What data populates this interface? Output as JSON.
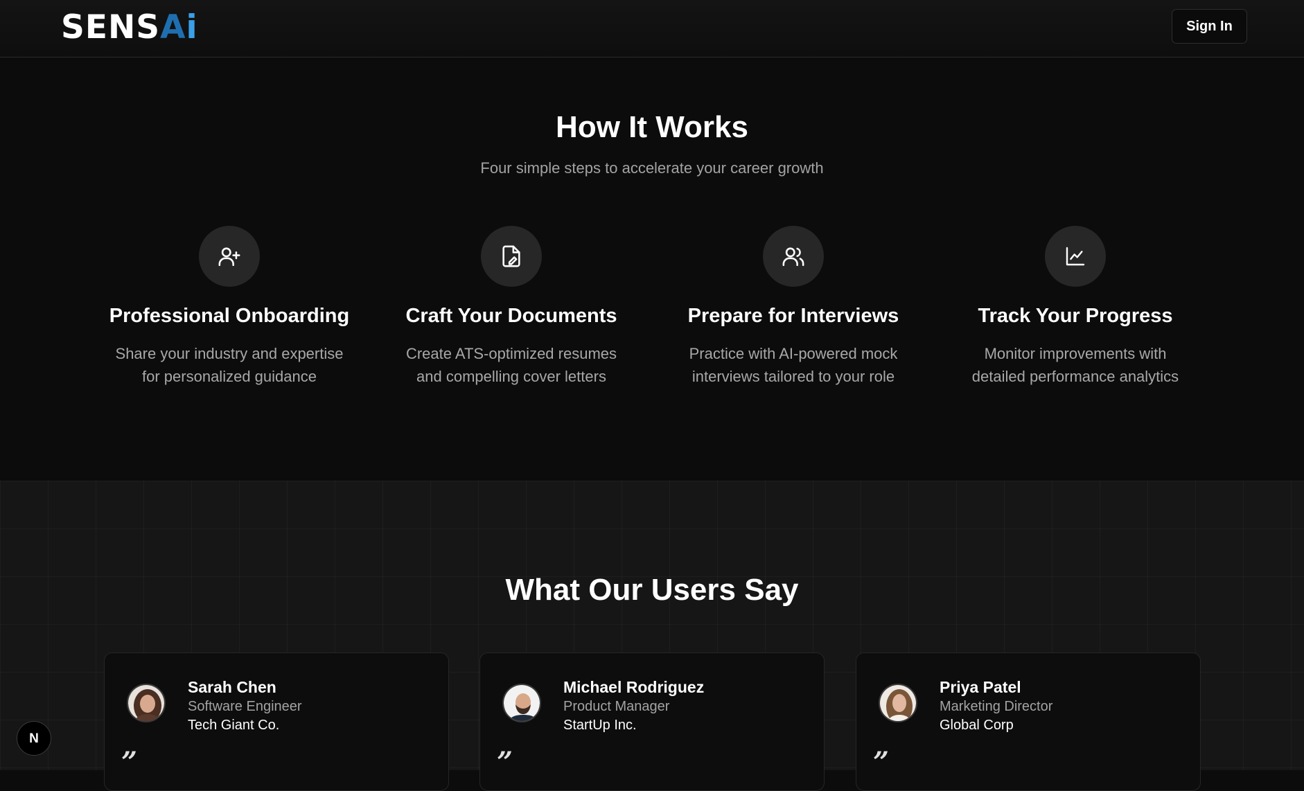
{
  "header": {
    "logo_text": "SENSAi",
    "sign_in_label": "Sign In"
  },
  "how_it_works": {
    "title": "How It Works",
    "subtitle": "Four simple steps to accelerate your career growth",
    "steps": [
      {
        "icon": "user-plus-icon",
        "title": "Professional Onboarding",
        "description": "Share your industry and expertise for personalized guidance"
      },
      {
        "icon": "file-edit-icon",
        "title": "Craft Your Documents",
        "description": "Create ATS-optimized resumes and compelling cover letters"
      },
      {
        "icon": "users-icon",
        "title": "Prepare for Interviews",
        "description": "Practice with AI-powered mock interviews tailored to your role"
      },
      {
        "icon": "line-chart-icon",
        "title": "Track Your Progress",
        "description": "Monitor improvements with detailed performance analytics"
      }
    ]
  },
  "testimonials": {
    "title": "What Our Users Say",
    "items": [
      {
        "name": "Sarah Chen",
        "role": "Software Engineer",
        "company": "Tech Giant Co.",
        "quote_mark": "”"
      },
      {
        "name": "Michael Rodriguez",
        "role": "Product Manager",
        "company": "StartUp Inc.",
        "quote_mark": "”"
      },
      {
        "name": "Priya Patel",
        "role": "Marketing Director",
        "company": "Global Corp",
        "quote_mark": "”"
      }
    ]
  },
  "dev_badge": {
    "label": "N"
  },
  "colors": {
    "background": "#0c0c0c",
    "section_alt": "#161616",
    "accent_blue": "#3aa0e8",
    "muted_text": "#a3a3a3"
  }
}
